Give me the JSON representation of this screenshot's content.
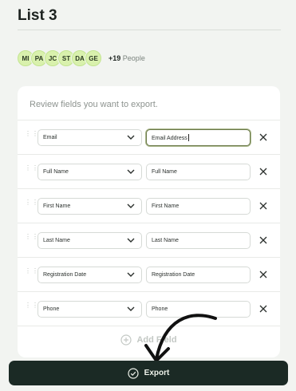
{
  "header": {
    "title": "List 3"
  },
  "avatars": {
    "initials": [
      "MI",
      "PA",
      "JC",
      "ST",
      "DA",
      "GE"
    ],
    "extra_count": "+19",
    "extra_label": "People"
  },
  "export_panel": {
    "heading": "Review fields you want to export.",
    "rows": [
      {
        "field": "Email",
        "label": "Email Address"
      },
      {
        "field": "Full Name",
        "label": "Full Name"
      },
      {
        "field": "First Name",
        "label": "First Name"
      },
      {
        "field": "Last Name",
        "label": "Last Name"
      },
      {
        "field": "Registration Date",
        "label": "Registration Date"
      },
      {
        "field": "Phone",
        "label": "Phone"
      }
    ],
    "add_field_label": "Add Field"
  },
  "footer": {
    "export_label": "Export"
  },
  "colors": {
    "primary_dark": "#1b2a25",
    "avatar_bg": "#d9f1ad",
    "active_border": "#6c7a4a"
  },
  "icons": [
    "drag-handle-icon",
    "chevron-down-icon",
    "close-icon",
    "plus-circle-icon",
    "check-circle-icon"
  ]
}
